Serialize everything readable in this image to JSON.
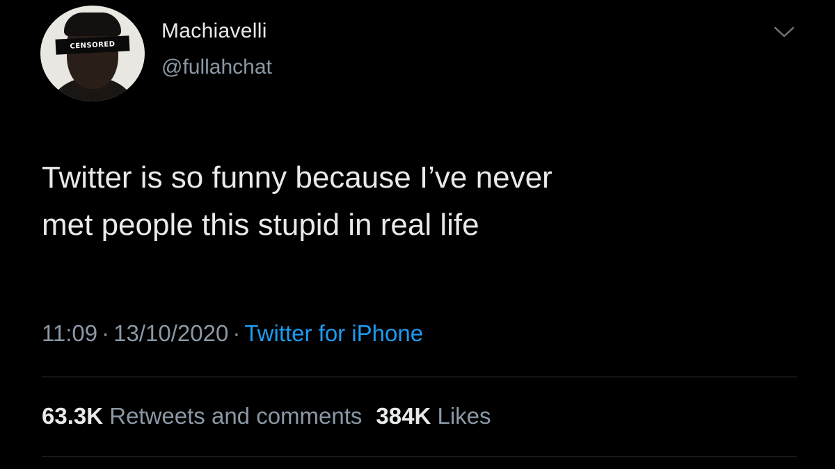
{
  "author": {
    "display_name": "Machiavelli",
    "handle": "@fullahchat",
    "avatar_overlay_text": "CENSORED"
  },
  "tweet": {
    "text_line_1": "Twitter is so funny because I’ve never",
    "text_line_2": "met people this stupid in real life"
  },
  "meta": {
    "time": "11:09",
    "separator": "·",
    "date": "13/10/2020",
    "source": "Twitter for iPhone"
  },
  "stats": {
    "retweets_count": "63.3K",
    "retweets_label": "Retweets and comments",
    "likes_count": "384K",
    "likes_label": "Likes"
  },
  "icons": {
    "menu": "chevron-down-icon"
  },
  "colors": {
    "background": "#000000",
    "primary_text": "#e7e9ea",
    "secondary_text": "#8b98a5",
    "accent": "#1d9bf0",
    "divider": "#2f3336"
  }
}
